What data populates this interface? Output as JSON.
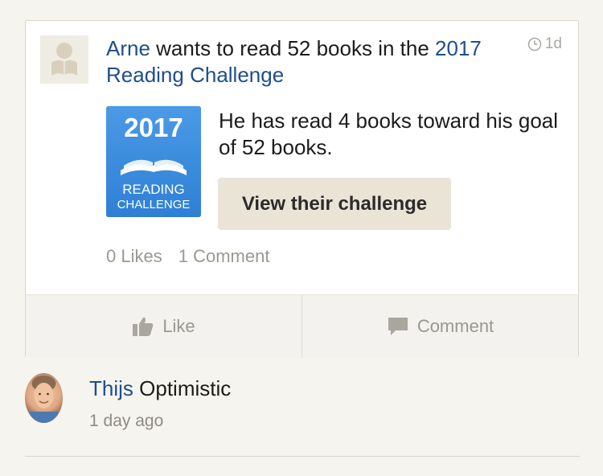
{
  "post": {
    "author": "Arne",
    "headline_middle": " wants to read 52 books in the ",
    "challenge_link": "2017 Reading Challenge",
    "time": "1d",
    "progress_text": "He has read 4 books toward his goal of 52 books.",
    "view_button": "View their challenge",
    "likes": "0 Likes",
    "comments": "1 Comment",
    "like_label": "Like",
    "comment_label": "Comment",
    "badge": {
      "year": "2017",
      "line1": "READING",
      "line2": "CHALLENGE"
    }
  },
  "comment": {
    "author": "Thijs",
    "text": " Optimistic",
    "time": "1 day ago"
  },
  "colors": {
    "link": "#1f4e8c",
    "badge": "#3d8fe0",
    "button_bg": "#e9e4d6",
    "muted": "#9b9890"
  }
}
